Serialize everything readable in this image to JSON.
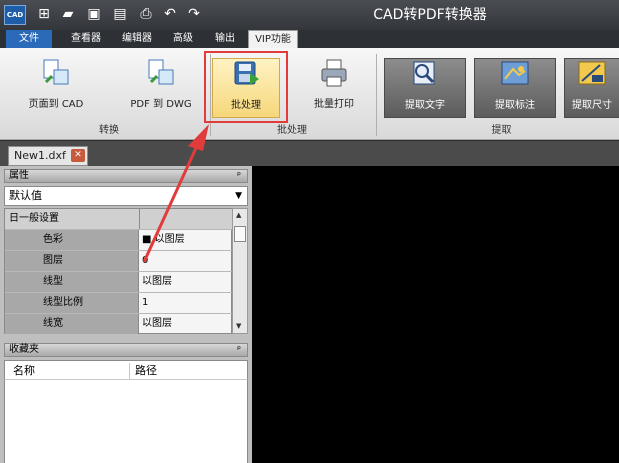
{
  "window": {
    "title": "CAD转PDF转换器",
    "logo_text": "CAD"
  },
  "quick_access": [
    "new-icon",
    "open-icon",
    "save-icon",
    "save-as-icon",
    "print-icon",
    "undo-icon",
    "redo-icon"
  ],
  "menu": {
    "items": [
      {
        "label": "文件"
      },
      {
        "label": "查看器"
      },
      {
        "label": "编辑器"
      },
      {
        "label": "高级"
      },
      {
        "label": "输出"
      },
      {
        "label": "VIP功能"
      }
    ]
  },
  "ribbon": {
    "buttons": [
      {
        "label": "页面到 CAD"
      },
      {
        "label": "PDF 到 DWG"
      },
      {
        "label": "批处理"
      },
      {
        "label": "批量打印"
      },
      {
        "label": "提取文字"
      },
      {
        "label": "提取标注"
      },
      {
        "label": "提取尺寸"
      }
    ],
    "groups": [
      {
        "label": "转换"
      },
      {
        "label": "批处理"
      },
      {
        "label": "提取"
      }
    ]
  },
  "document_tab": {
    "label": "New1.dxf"
  },
  "properties": {
    "title": "属性",
    "pin": "ᵖ",
    "selected": "默认值",
    "section": "日一般设置",
    "rows": [
      {
        "key": "色彩",
        "value": "■ 以图层"
      },
      {
        "key": "图层",
        "value": "0"
      },
      {
        "key": "线型",
        "value": "以图层"
      },
      {
        "key": "线型比例",
        "value": "1"
      },
      {
        "key": "线宽",
        "value": "以图层"
      }
    ]
  },
  "favorites": {
    "title": "收藏夹",
    "col_name": "名称",
    "col_path": "路径"
  },
  "colors": {
    "highlight": "#e23b3b",
    "menu_active": "#2b6ab8"
  }
}
